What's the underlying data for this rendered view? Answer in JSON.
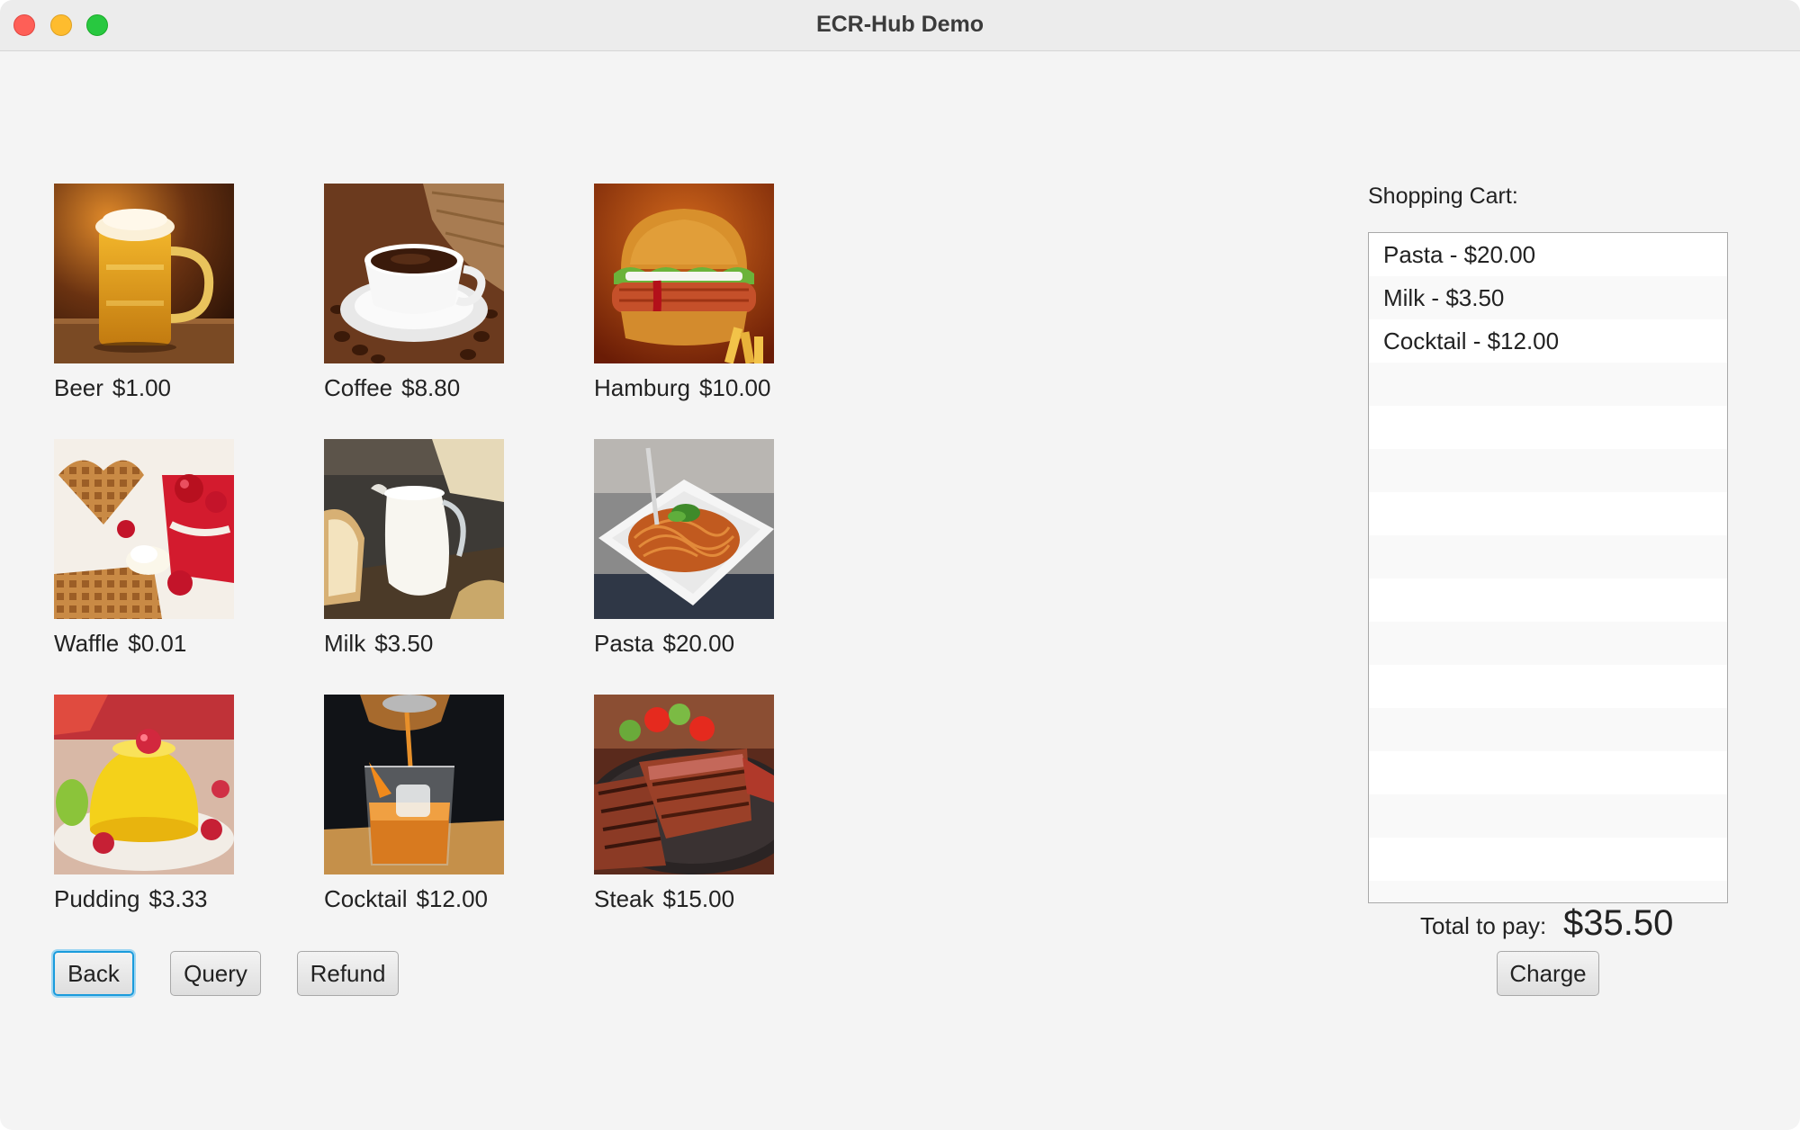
{
  "window": {
    "title": "ECR-Hub Demo"
  },
  "products": [
    {
      "name": "Beer",
      "price": "$1.00",
      "icon": "beer-image"
    },
    {
      "name": "Coffee",
      "price": "$8.80",
      "icon": "coffee-image"
    },
    {
      "name": "Hamburg",
      "price": "$10.00",
      "icon": "hamburger-image"
    },
    {
      "name": "Waffle",
      "price": "$0.01",
      "icon": "waffle-image"
    },
    {
      "name": "Milk",
      "price": "$3.50",
      "icon": "milk-image"
    },
    {
      "name": "Pasta",
      "price": "$20.00",
      "icon": "pasta-image"
    },
    {
      "name": "Pudding",
      "price": "$3.33",
      "icon": "pudding-image"
    },
    {
      "name": "Cocktail",
      "price": "$12.00",
      "icon": "cocktail-image"
    },
    {
      "name": "Steak",
      "price": "$15.00",
      "icon": "steak-image"
    }
  ],
  "actions": {
    "back_label": "Back",
    "query_label": "Query",
    "refund_label": "Refund"
  },
  "cart": {
    "title": "Shopping Cart:",
    "items": [
      "Pasta - $20.00",
      "Milk - $3.50",
      "Cocktail - $12.00"
    ],
    "total_label": "Total to pay:",
    "total_value": "$35.50",
    "charge_label": "Charge"
  },
  "colors": {
    "focus_ring": "#1a9bdc",
    "window_bg": "#f4f4f4",
    "close": "#fe5f57",
    "minimize": "#febc2e",
    "zoom": "#28c840"
  }
}
